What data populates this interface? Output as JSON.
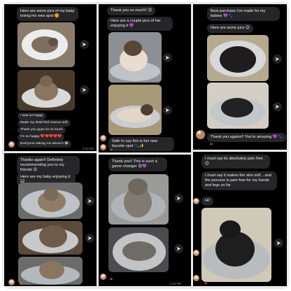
{
  "panel1": {
    "top_bubbles": [
      "Here are some pics of my baby loving his new spot 🥰"
    ],
    "small_bubbles": [
      "I was so happy",
      "Made my desk feel sooooo soft",
      "Thank you guys so so much",
      "I'm so happy ❤️❤️❤️❤️❤️",
      "Everyone asking me about it 😂"
    ],
    "timestamp": "3:31 PM"
  },
  "panel2": {
    "bubbles": [
      "Thanks again!! Definitely recommending you to my friends 😊",
      "Here are my baby enjoying it 🐱"
    ]
  },
  "panel3": {
    "top_bubbles": [
      "Thank you so much!! 😊",
      "Here are a couple pics of her enjoying it 💜"
    ],
    "caption": "Safe to say this is her new favorite spot 🐾✨"
  },
  "panel4": {
    "bubble": "Thank you!! This is such a game changer 😍💜",
    "timestamp": "4:22 PM"
  },
  "panel5": {
    "bubbles": [
      "Best purchase I've made for my babies 💜🐾",
      "Here are some pics 😊"
    ],
    "reply": "Thank you againn!! You're amazing 💜🐾"
  },
  "panel6": {
    "bubbles": [
      "I must say its absolutely pain free 😊",
      "I must say it makes the skin soft... and the process is pain free for my hands and legs so far",
      "Hi!"
    ]
  },
  "icons": {
    "share": "paper-plane-icon",
    "heart": "heart-reaction-icon"
  },
  "colors": {
    "bubble": "#262628",
    "panel": "#000000",
    "frame": "#e9e9ea",
    "heart": "#ff3b4a"
  }
}
